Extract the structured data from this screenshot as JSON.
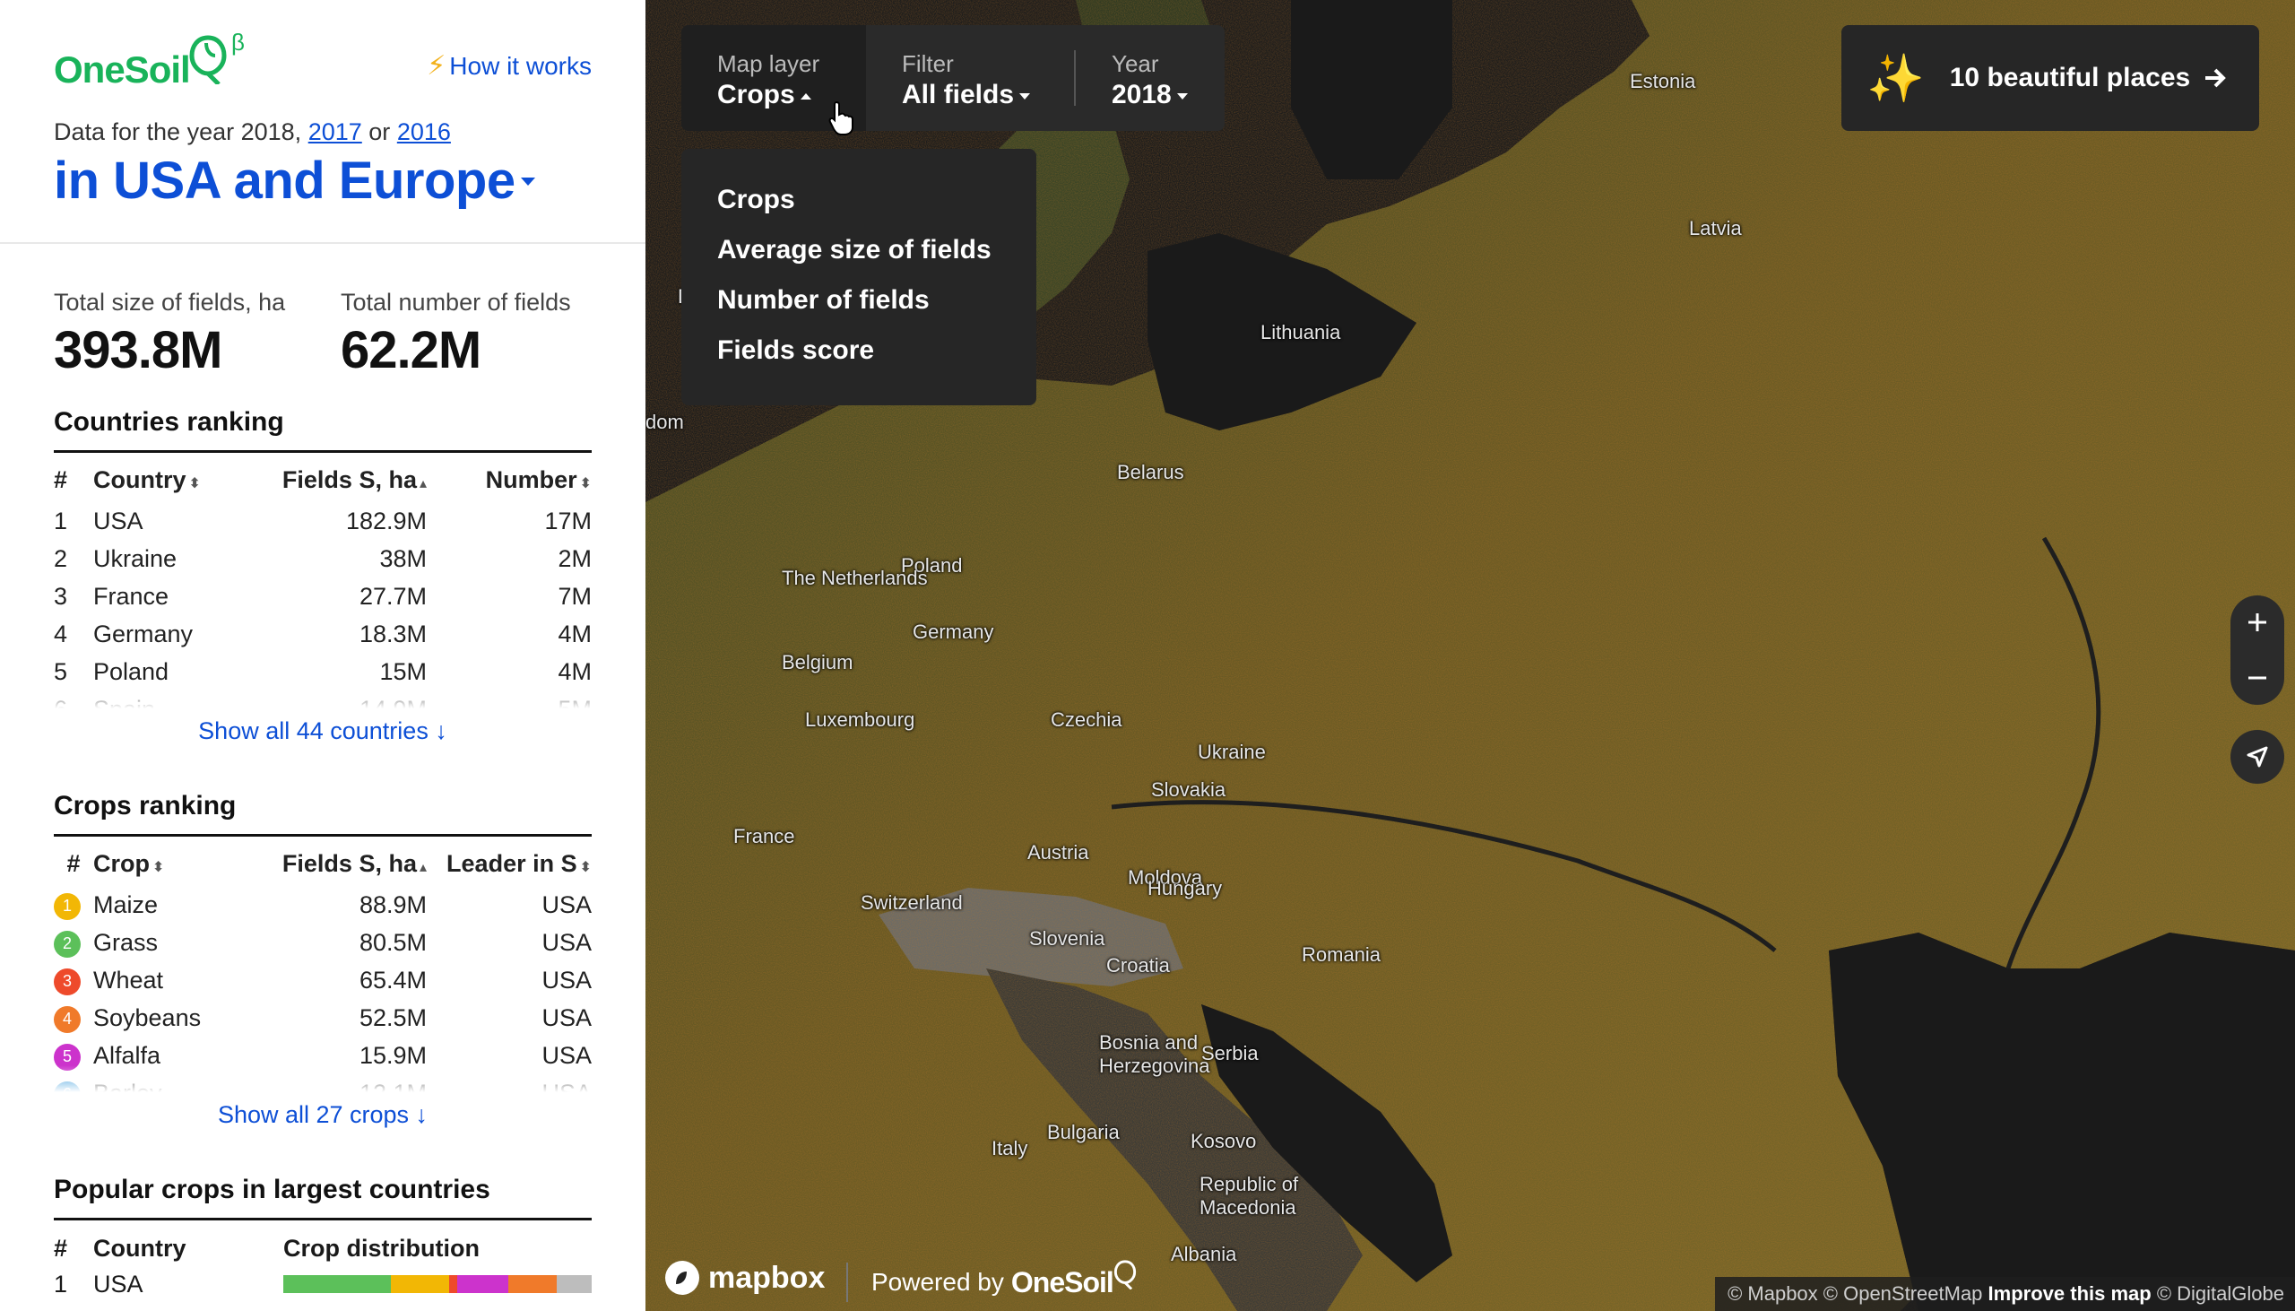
{
  "brand": {
    "name": "OneSoil",
    "beta": "β"
  },
  "header": {
    "how_it_works": "How it works",
    "year_prefix": "Data for the year 2018,",
    "year_link_1": "2017",
    "year_or": "or",
    "year_link_2": "2016",
    "region": "in USA and Europe"
  },
  "stats": {
    "total_size_label": "Total size of fields, ha",
    "total_size_value": "393.8M",
    "total_number_label": "Total number of fields",
    "total_number_value": "62.2M"
  },
  "countries": {
    "title": "Countries ranking",
    "col_idx": "#",
    "col_name": "Country",
    "col_s": "Fields S, ha",
    "col_n": "Number",
    "rows": [
      {
        "idx": "1",
        "name": "USA",
        "s": "182.9M",
        "n": "17M"
      },
      {
        "idx": "2",
        "name": "Ukraine",
        "s": "38M",
        "n": "2M"
      },
      {
        "idx": "3",
        "name": "France",
        "s": "27.7M",
        "n": "7M"
      },
      {
        "idx": "4",
        "name": "Germany",
        "s": "18.3M",
        "n": "4M"
      },
      {
        "idx": "5",
        "name": "Poland",
        "s": "15M",
        "n": "4M"
      },
      {
        "idx": "6",
        "name": "Spain",
        "s": "14.9M",
        "n": "5M"
      }
    ],
    "show_all": "Show all 44 countries ↓"
  },
  "crops": {
    "title": "Crops ranking",
    "col_idx": "#",
    "col_name": "Crop",
    "col_s": "Fields S, ha",
    "col_leader": "Leader in S",
    "rows": [
      {
        "idx": "1",
        "name": "Maize",
        "s": "88.9M",
        "leader": "USA",
        "color": "#f2b705"
      },
      {
        "idx": "2",
        "name": "Grass",
        "s": "80.5M",
        "leader": "USA",
        "color": "#5cc05a"
      },
      {
        "idx": "3",
        "name": "Wheat",
        "s": "65.4M",
        "leader": "USA",
        "color": "#ee4a2b"
      },
      {
        "idx": "4",
        "name": "Soybeans",
        "s": "52.5M",
        "leader": "USA",
        "color": "#f07a2a"
      },
      {
        "idx": "5",
        "name": "Alfalfa",
        "s": "15.9M",
        "leader": "USA",
        "color": "#cc33cc"
      },
      {
        "idx": "6",
        "name": "Barley",
        "s": "12.1M",
        "leader": "USA",
        "color": "#1a8ad6"
      }
    ],
    "show_all": "Show all 27 crops ↓"
  },
  "popular": {
    "title": "Popular crops in largest countries",
    "col_idx": "#",
    "col_country": "Country",
    "col_dist": "Crop distribution",
    "rows": [
      {
        "idx": "1",
        "country": "USA",
        "distribution": [
          {
            "share": 0.2,
            "color": "#5cc05a"
          },
          {
            "share": 0.11,
            "color": "#f2b705"
          },
          {
            "share": 0.015,
            "color": "#ee4a2b"
          },
          {
            "share": 0.095,
            "color": "#cc33cc"
          },
          {
            "share": 0.09,
            "color": "#f07a2a"
          },
          {
            "share": 0.065,
            "color": "#bdbdbd"
          }
        ]
      }
    ]
  },
  "map_controls": {
    "layer_label": "Map layer",
    "layer_value": "Crops",
    "filter_label": "Filter",
    "filter_value": "All fields",
    "year_label": "Year",
    "year_value": "2018",
    "layer_menu": [
      "Crops",
      "Average size of fields",
      "Number of fields",
      "Fields score"
    ],
    "beautiful_places": "10 beautiful places"
  },
  "map_labels": [
    "Estonia",
    "Latvia",
    "Denmark",
    "Lithuania",
    "dom",
    "Belarus",
    "Poland",
    "The Netherlands",
    "Germany",
    "Belgium",
    "Luxembourg",
    "Czechia",
    "Ukraine",
    "Slovakia",
    "France",
    "Austria",
    "Moldova",
    "Switzerland",
    "Hungary",
    "Slovenia",
    "Croatia",
    "Romania",
    "Bosnia and",
    "Herzegovina",
    "Serbia",
    "Italy",
    "Kosovo",
    "Bulgaria",
    "Republic of",
    "Macedonia",
    "Albania"
  ],
  "footer": {
    "mapbox": "mapbox",
    "powered_by": "Powered by",
    "onesoil": "OneSoil",
    "attrib_1": "© Mapbox © OpenStreetMap",
    "attrib_improve": "Improve this map",
    "attrib_2": "© DigitalGlobe"
  },
  "colors": {
    "brand_green": "#19b35a",
    "link_blue": "#0d4fd6",
    "panel_dark": "#2a2a2a"
  }
}
